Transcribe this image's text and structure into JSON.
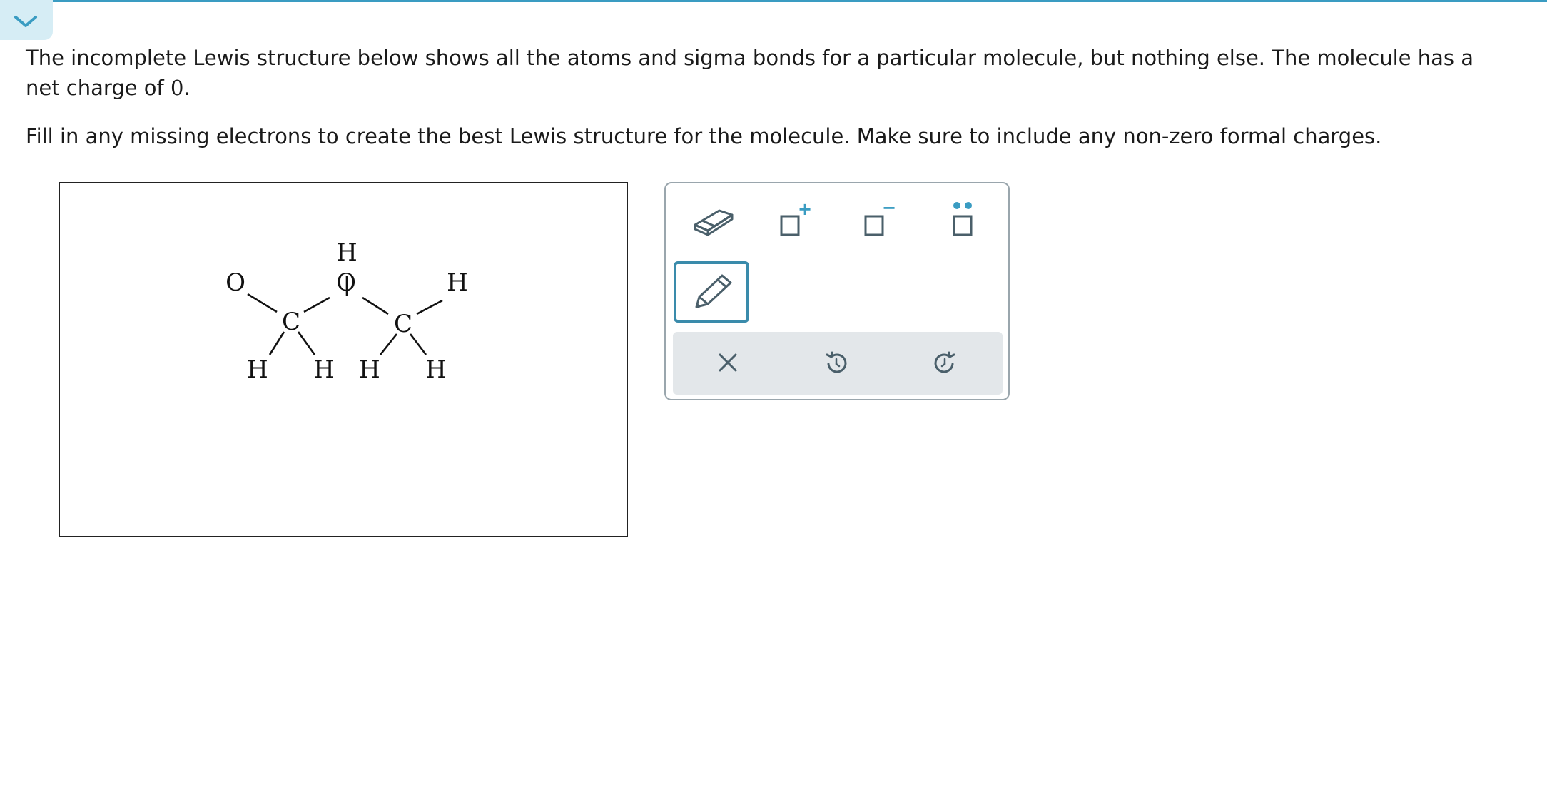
{
  "question": {
    "line1_text": "The incomplete Lewis structure below shows all the atoms and sigma bonds for a particular molecule, but nothing else. The molecule has a net charge of ",
    "net_charge": "0",
    "line1_end": ".",
    "line2_text": "Fill in any missing electrons to create the best Lewis structure for the molecule. Make sure to include any non-zero formal charges."
  },
  "molecule": {
    "atoms": {
      "o_left": "O",
      "c_left": "C",
      "o_mid": "O",
      "h_top": "H",
      "c_right": "C",
      "h_right": "H",
      "h1": "H",
      "h2": "H",
      "h3": "H",
      "h4": "H"
    }
  },
  "toolbar": {
    "tools": [
      "eraser-icon",
      "positive-charge-icon",
      "negative-charge-icon",
      "lone-pair-icon",
      "pencil-icon"
    ],
    "plus_sign": "+",
    "minus_sign": "−",
    "actions": [
      "clear-icon",
      "undo-icon",
      "redo-icon"
    ]
  },
  "colors": {
    "accent": "#3a9cc2",
    "pencil_border": "#3a8bab",
    "toolbar_border": "#9aa6ad",
    "action_bar_bg": "#e3e7ea",
    "icon_gray": "#4a5f6a",
    "lone_pair_dots": "#3a9cc2"
  }
}
